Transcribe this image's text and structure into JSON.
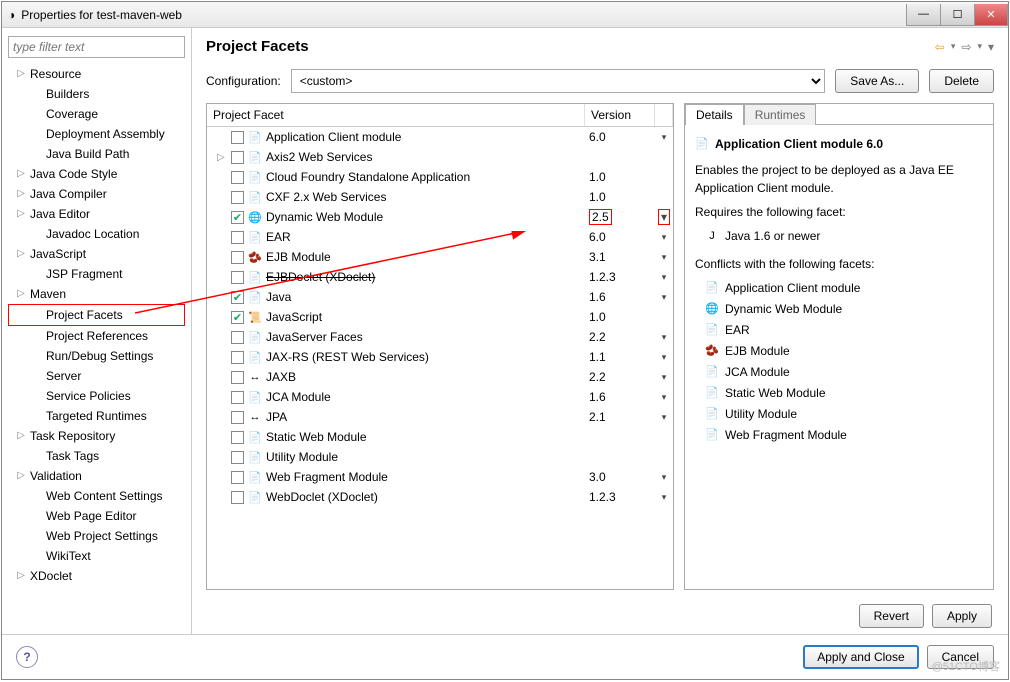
{
  "window_title": "Properties for test-maven-web",
  "filter_placeholder": "type filter text",
  "page_title": "Project Facets",
  "tree": [
    {
      "label": "Resource",
      "expand": true
    },
    {
      "label": "Builders"
    },
    {
      "label": "Coverage"
    },
    {
      "label": "Deployment Assembly"
    },
    {
      "label": "Java Build Path"
    },
    {
      "label": "Java Code Style",
      "expand": true
    },
    {
      "label": "Java Compiler",
      "expand": true
    },
    {
      "label": "Java Editor",
      "expand": true
    },
    {
      "label": "Javadoc Location"
    },
    {
      "label": "JavaScript",
      "expand": true
    },
    {
      "label": "JSP Fragment"
    },
    {
      "label": "Maven",
      "expand": true
    },
    {
      "label": "Project Facets",
      "selected": true
    },
    {
      "label": "Project References"
    },
    {
      "label": "Run/Debug Settings"
    },
    {
      "label": "Server"
    },
    {
      "label": "Service Policies"
    },
    {
      "label": "Targeted Runtimes"
    },
    {
      "label": "Task Repository",
      "expand": true
    },
    {
      "label": "Task Tags"
    },
    {
      "label": "Validation",
      "expand": true
    },
    {
      "label": "Web Content Settings"
    },
    {
      "label": "Web Page Editor"
    },
    {
      "label": "Web Project Settings"
    },
    {
      "label": "WikiText"
    },
    {
      "label": "XDoclet",
      "expand": true
    }
  ],
  "config_label": "Configuration:",
  "config_value": "<custom>",
  "save_as": "Save As...",
  "delete_btn": "Delete",
  "col_facet": "Project Facet",
  "col_version": "Version",
  "facets": [
    {
      "name": "Application Client module",
      "ver": "6.0",
      "drop": true,
      "icon": "📄"
    },
    {
      "name": "Axis2 Web Services",
      "ver": "",
      "drop": false,
      "icon": "📄",
      "expand": true
    },
    {
      "name": "Cloud Foundry Standalone Application",
      "ver": "1.0",
      "drop": false,
      "icon": "📄"
    },
    {
      "name": "CXF 2.x Web Services",
      "ver": "1.0",
      "drop": false,
      "icon": "📄"
    },
    {
      "name": "Dynamic Web Module",
      "ver": "2.5",
      "drop": true,
      "icon": "🌐",
      "checked": true,
      "hl": true
    },
    {
      "name": "EAR",
      "ver": "6.0",
      "drop": true,
      "icon": "📄"
    },
    {
      "name": "EJB Module",
      "ver": "3.1",
      "drop": true,
      "icon": "🫘"
    },
    {
      "name": "EJBDoclet (XDoclet)",
      "ver": "1.2.3",
      "drop": true,
      "icon": "📄",
      "strike": true
    },
    {
      "name": "Java",
      "ver": "1.6",
      "drop": true,
      "icon": "📄",
      "checked": true
    },
    {
      "name": "JavaScript",
      "ver": "1.0",
      "drop": false,
      "icon": "📜",
      "checked": true
    },
    {
      "name": "JavaServer Faces",
      "ver": "2.2",
      "drop": true,
      "icon": "📄"
    },
    {
      "name": "JAX-RS (REST Web Services)",
      "ver": "1.1",
      "drop": true,
      "icon": "📄"
    },
    {
      "name": "JAXB",
      "ver": "2.2",
      "drop": true,
      "icon": "↔"
    },
    {
      "name": "JCA Module",
      "ver": "1.6",
      "drop": true,
      "icon": "📄"
    },
    {
      "name": "JPA",
      "ver": "2.1",
      "drop": true,
      "icon": "↔"
    },
    {
      "name": "Static Web Module",
      "ver": "",
      "drop": false,
      "icon": "📄"
    },
    {
      "name": "Utility Module",
      "ver": "",
      "drop": false,
      "icon": "📄"
    },
    {
      "name": "Web Fragment Module",
      "ver": "3.0",
      "drop": true,
      "icon": "📄"
    },
    {
      "name": "WebDoclet (XDoclet)",
      "ver": "1.2.3",
      "drop": true,
      "icon": "📄"
    }
  ],
  "tabs": {
    "details": "Details",
    "runtimes": "Runtimes"
  },
  "details": {
    "title": "Application Client module 6.0",
    "desc": "Enables the project to be deployed as a Java EE Application Client module.",
    "req_label": "Requires the following facet:",
    "req": [
      "Java 1.6 or newer"
    ],
    "conf_label": "Conflicts with the following facets:",
    "conf": [
      "Application Client module",
      "Dynamic Web Module",
      "EAR",
      "EJB Module",
      "JCA Module",
      "Static Web Module",
      "Utility Module",
      "Web Fragment Module"
    ]
  },
  "revert": "Revert",
  "apply": "Apply",
  "apply_close": "Apply and Close",
  "cancel": "Cancel",
  "watermark": "@51CTO博客"
}
